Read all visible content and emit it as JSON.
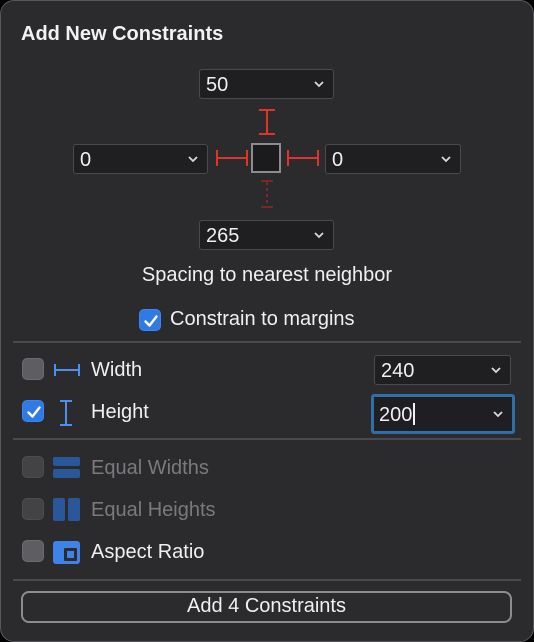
{
  "title": "Add New Constraints",
  "spacing": {
    "top": "50",
    "left": "0",
    "right": "0",
    "bottom": "265",
    "label": "Spacing to nearest neighbor"
  },
  "constrain_margins": {
    "label": "Constrain to margins",
    "checked": true
  },
  "size": {
    "width": {
      "label": "Width",
      "value": "240",
      "checked": false
    },
    "height": {
      "label": "Height",
      "value": "200",
      "checked": true
    }
  },
  "options": {
    "equal_widths": {
      "label": "Equal Widths",
      "enabled": false
    },
    "equal_heights": {
      "label": "Equal Heights",
      "enabled": false
    },
    "aspect_ratio": {
      "label": "Aspect Ratio",
      "enabled": true
    }
  },
  "add_button": {
    "label": "Add 4 Constraints"
  },
  "colors": {
    "accent": "#2f7ae5",
    "constraint": "#e0342b",
    "panel": "#2b2b2e"
  }
}
